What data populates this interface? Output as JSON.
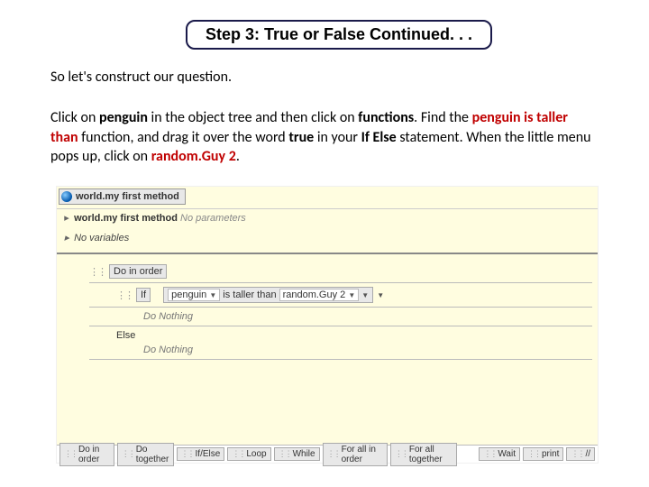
{
  "title": "Step 3: True or False Continued. . .",
  "intro": "So let's construct our question.",
  "para1_a": "Click on ",
  "para1_penguin": "penguin",
  "para1_b": " in the object tree and then click on ",
  "para1_functions": "functions",
  "para1_c": ". Find the ",
  "para1_taller": "penguin is taller than",
  "para1_d": " function, and drag it over the word ",
  "para1_true": "true",
  "para1_e": " in your ",
  "para1_ifelse": "If Else",
  "para1_f": " statement. When the little menu pops up, click on ",
  "para1_random": "random.Guy 2",
  "para1_g": ".",
  "tab_label": "world.my first method",
  "row2_title": "world.my first method",
  "row2_noparams": "No parameters",
  "novars": "No variables",
  "do_in_order": "Do in order",
  "if_label": "If",
  "penguin_tile": "penguin",
  "taller_label": "is taller than",
  "random_tile": "random.Guy 2",
  "do_nothing": "Do Nothing",
  "else_label": "Else",
  "palette": {
    "do_in_order": "Do in order",
    "do_together": "Do together",
    "if_else": "If/Else",
    "loop": "Loop",
    "while": "While",
    "for_all_in_order": "For all in order",
    "for_all_together": "For all together",
    "wait": "Wait",
    "print": "print",
    "script": "//"
  }
}
